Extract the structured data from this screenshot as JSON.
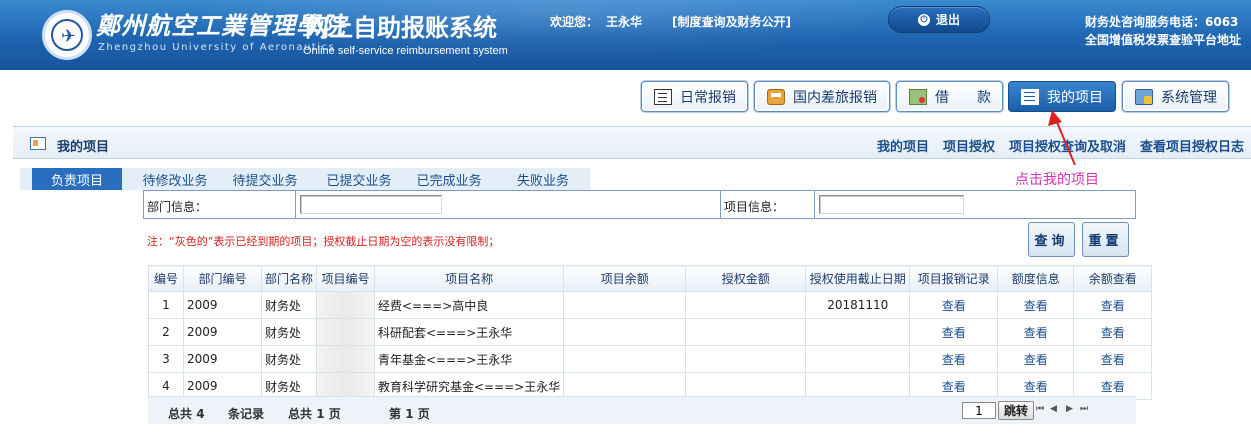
{
  "header": {
    "school_cn": "鄭州航空工業管理學院",
    "school_en": "Zhengzhou University of Aeronautics",
    "system_cn": "网上自助报账系统",
    "system_en": "Online self-service reimbursement system",
    "welcome_label": "欢迎您：",
    "user_name": "王永华",
    "policy_link": "[制度查询及财务公开]",
    "logout": "退出",
    "hotline": "财务处咨询服务电话：6063",
    "vat_link": "全国增值税发票查验平台地址"
  },
  "nav": [
    {
      "label": "日常报销",
      "icon": "document-icon"
    },
    {
      "label": "国内差旅报销",
      "icon": "bus-icon"
    },
    {
      "label": "借　　款",
      "icon": "money-icon"
    },
    {
      "label": "我的项目",
      "icon": "list-icon",
      "active": true
    },
    {
      "label": "系统管理",
      "icon": "system-icon"
    }
  ],
  "panel": {
    "title": "我的项目",
    "links": [
      "我的项目",
      "项目授权",
      "项目授权查询及取消",
      "查看项目授权日志"
    ]
  },
  "tabs": [
    "负责项目",
    "待修改业务",
    "待提交业务",
    "已提交业务",
    "已完成业务",
    "失败业务"
  ],
  "annotation": "点击我的项目",
  "filter": {
    "dept_label": "部门信息：",
    "dept_value": "",
    "project_label": "项目信息：",
    "project_value": ""
  },
  "note": "注：“灰色的”表示已经到期的项目；授权截止日期为空的表示没有限制；",
  "buttons": {
    "query": "查询",
    "reset": "重置"
  },
  "table": {
    "headers": [
      "编号",
      "部门编号",
      "部门名称",
      "项目编号",
      "项目名称",
      "项目余额",
      "授权金额",
      "授权使用截止日期",
      "项目报销记录",
      "额度信息",
      "余额查看"
    ],
    "rows": [
      {
        "no": "1",
        "dept_no": "2009",
        "dept_name": "财务处",
        "proj_no": "",
        "proj_name": "经费<===>高中良",
        "balance": "",
        "auth_amount": "",
        "deadline": "20181110",
        "record": "查看",
        "quota": "查看",
        "view": "查看"
      },
      {
        "no": "2",
        "dept_no": "2009",
        "dept_name": "财务处",
        "proj_no": "",
        "proj_name": "科研配套<===>王永华",
        "balance": "",
        "auth_amount": "",
        "deadline": "",
        "record": "查看",
        "quota": "查看",
        "view": "查看"
      },
      {
        "no": "3",
        "dept_no": "2009",
        "dept_name": "财务处",
        "proj_no": "",
        "proj_name": "青年基金<===>王永华",
        "balance": "",
        "auth_amount": "",
        "deadline": "",
        "record": "查看",
        "quota": "查看",
        "view": "查看"
      },
      {
        "no": "4",
        "dept_no": "2009",
        "dept_name": "财务处",
        "proj_no": "",
        "proj_name": "教育科学研究基金<===>王永华",
        "balance": "",
        "auth_amount": "",
        "deadline": "",
        "record": "查看",
        "quota": "查看",
        "view": "查看"
      }
    ]
  },
  "pager": {
    "total_label": "总共",
    "total_records": "4",
    "records_unit": "条记录",
    "total_pages_label": "总共",
    "total_pages": "1",
    "pages_unit": "页",
    "current_label": "第",
    "current_page": "1",
    "current_unit": "页",
    "page_input": "1",
    "jump": "跳转",
    "first": "⏮",
    "prev": "◀",
    "next": "▶",
    "last": "⏭"
  }
}
